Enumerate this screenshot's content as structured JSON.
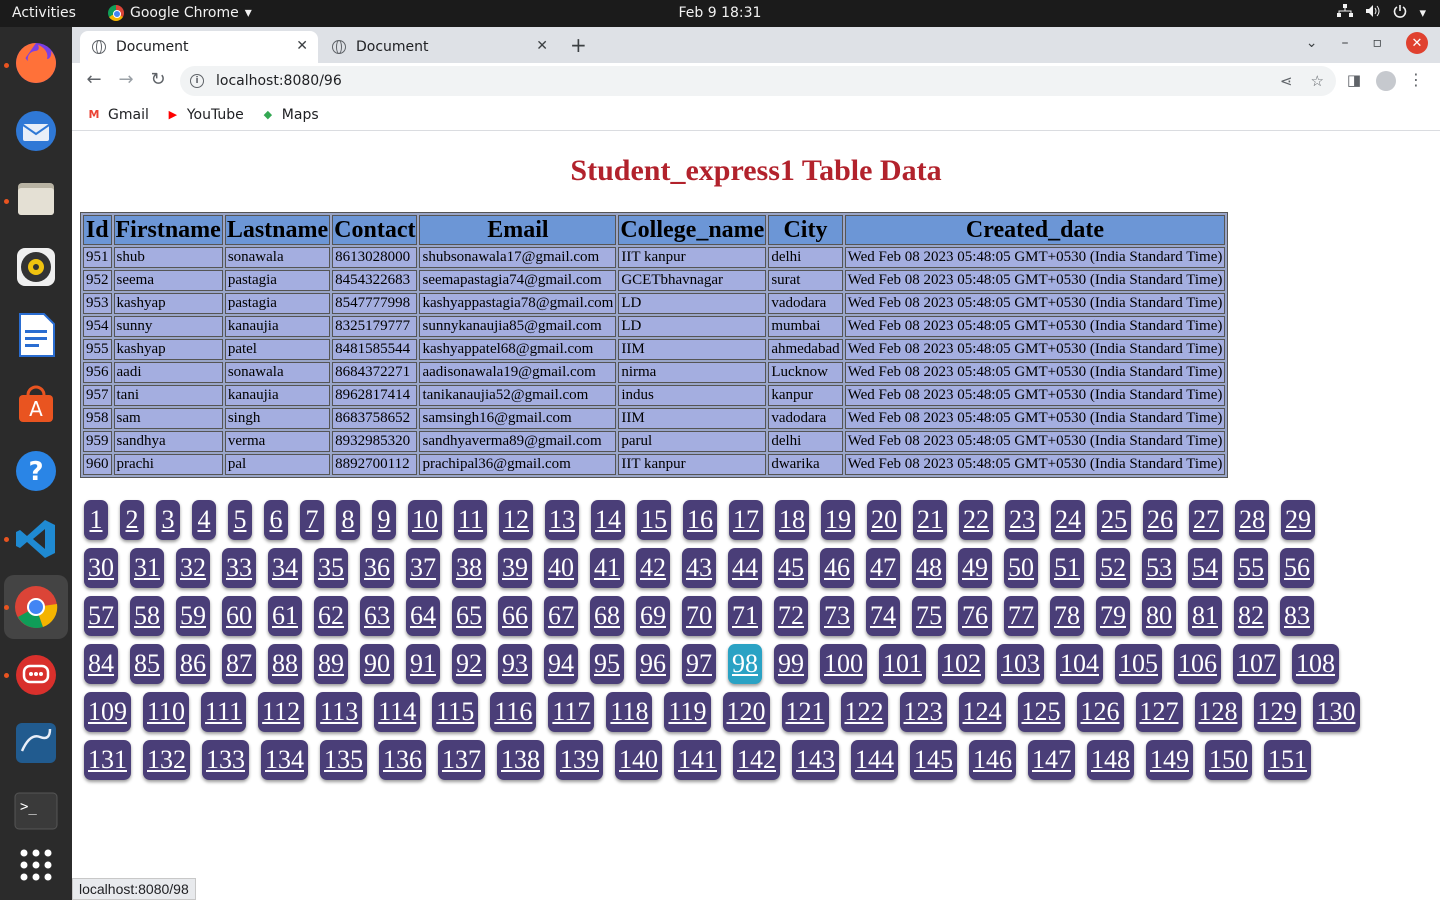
{
  "topbar": {
    "activities": "Activities",
    "app_name": "Google Chrome",
    "app_caret": "▾",
    "clock": "Feb 9  18:31",
    "tray_icons": [
      "network-icon",
      "volume-icon",
      "power-icon",
      "chevron-down-icon"
    ]
  },
  "dock": {
    "items": [
      "firefox-icon",
      "thunderbird-icon",
      "files-icon",
      "rhythmbox-icon",
      "writer-icon",
      "software-icon",
      "help-icon",
      "vscode-icon",
      "chrome-icon",
      "chat-icon",
      "mysql-workbench-icon",
      "terminal-icon",
      "app-grid-icon"
    ],
    "colors": {
      "firefox": "#ff7139",
      "thunderbird": "#2f78d6",
      "files": "#d8d4c6",
      "rhythmbox": "#f0c30f",
      "writer": "#2a6dd1",
      "software": "#e95420",
      "help": "#2a85e6",
      "vscode": "#1f8ad2",
      "chrome": "#4285f4",
      "chat": "#d9302c",
      "mysql": "#215b8f",
      "terminal": "#3a3a3a",
      "grid": "#ffffff"
    }
  },
  "browser": {
    "tabs": [
      {
        "title": "Document",
        "active": true
      },
      {
        "title": "Document",
        "active": false
      }
    ],
    "tab_close": "✕",
    "new_tab": "+",
    "url": "localhost:8080/96",
    "info_icon": "i",
    "bookmarks": [
      {
        "label": "Gmail",
        "icon": "gmail-icon",
        "color": "#ea4335"
      },
      {
        "label": "YouTube",
        "icon": "youtube-icon",
        "color": "#ff0000"
      },
      {
        "label": "Maps",
        "icon": "maps-icon",
        "color": "#34a853"
      }
    ],
    "status_url": "localhost:8080/98"
  },
  "page": {
    "title": "Student_express1 Table Data",
    "table": {
      "headers": [
        "Id",
        "Firstname",
        "Lastname",
        "Contact",
        "Email",
        "College_name",
        "City",
        "Created_date"
      ],
      "rows": [
        [
          "951",
          "shub",
          "sonawala",
          "8613028000",
          "shubsonawala17@gmail.com",
          "IIT kanpur",
          "delhi",
          "Wed Feb 08 2023 05:48:05 GMT+0530 (India Standard Time)"
        ],
        [
          "952",
          "seema",
          "pastagia",
          "8454322683",
          "seemapastagia74@gmail.com",
          "GCETbhavnagar",
          "surat",
          "Wed Feb 08 2023 05:48:05 GMT+0530 (India Standard Time)"
        ],
        [
          "953",
          "kashyap",
          "pastagia",
          "8547777998",
          "kashyappastagia78@gmail.com",
          "LD",
          "vadodara",
          "Wed Feb 08 2023 05:48:05 GMT+0530 (India Standard Time)"
        ],
        [
          "954",
          "sunny",
          "kanaujia",
          "8325179777",
          "sunnykanaujia85@gmail.com",
          "LD",
          "mumbai",
          "Wed Feb 08 2023 05:48:05 GMT+0530 (India Standard Time)"
        ],
        [
          "955",
          "kashyap",
          "patel",
          "8481585544",
          "kashyappatel68@gmail.com",
          "IIM",
          "ahmedabad",
          "Wed Feb 08 2023 05:48:05 GMT+0530 (India Standard Time)"
        ],
        [
          "956",
          "aadi",
          "sonawala",
          "8684372271",
          "aadisonawala19@gmail.com",
          "nirma",
          "Lucknow",
          "Wed Feb 08 2023 05:48:05 GMT+0530 (India Standard Time)"
        ],
        [
          "957",
          "tani",
          "kanaujia",
          "8962817414",
          "tanikanaujia52@gmail.com",
          "indus",
          "kanpur",
          "Wed Feb 08 2023 05:48:05 GMT+0530 (India Standard Time)"
        ],
        [
          "958",
          "sam",
          "singh",
          "8683758652",
          "samsingh16@gmail.com",
          "IIM",
          "vadodara",
          "Wed Feb 08 2023 05:48:05 GMT+0530 (India Standard Time)"
        ],
        [
          "959",
          "sandhya",
          "verma",
          "8932985320",
          "sandhyaverma89@gmail.com",
          "parul",
          "delhi",
          "Wed Feb 08 2023 05:48:05 GMT+0530 (India Standard Time)"
        ],
        [
          "960",
          "prachi",
          "pal",
          "8892700112",
          "prachipal36@gmail.com",
          "IIT kanpur",
          "dwarika",
          "Wed Feb 08 2023 05:48:05 GMT+0530 (India Standard Time)"
        ]
      ]
    },
    "pagination": {
      "total_pages": 151,
      "current_page": 98,
      "rows": [
        [
          1,
          29
        ],
        [
          30,
          56
        ],
        [
          57,
          83
        ],
        [
          84,
          108
        ],
        [
          109,
          130
        ],
        [
          131,
          151
        ]
      ],
      "colors": {
        "button": "#4a3e78",
        "current": "#2aa2c4"
      }
    }
  }
}
